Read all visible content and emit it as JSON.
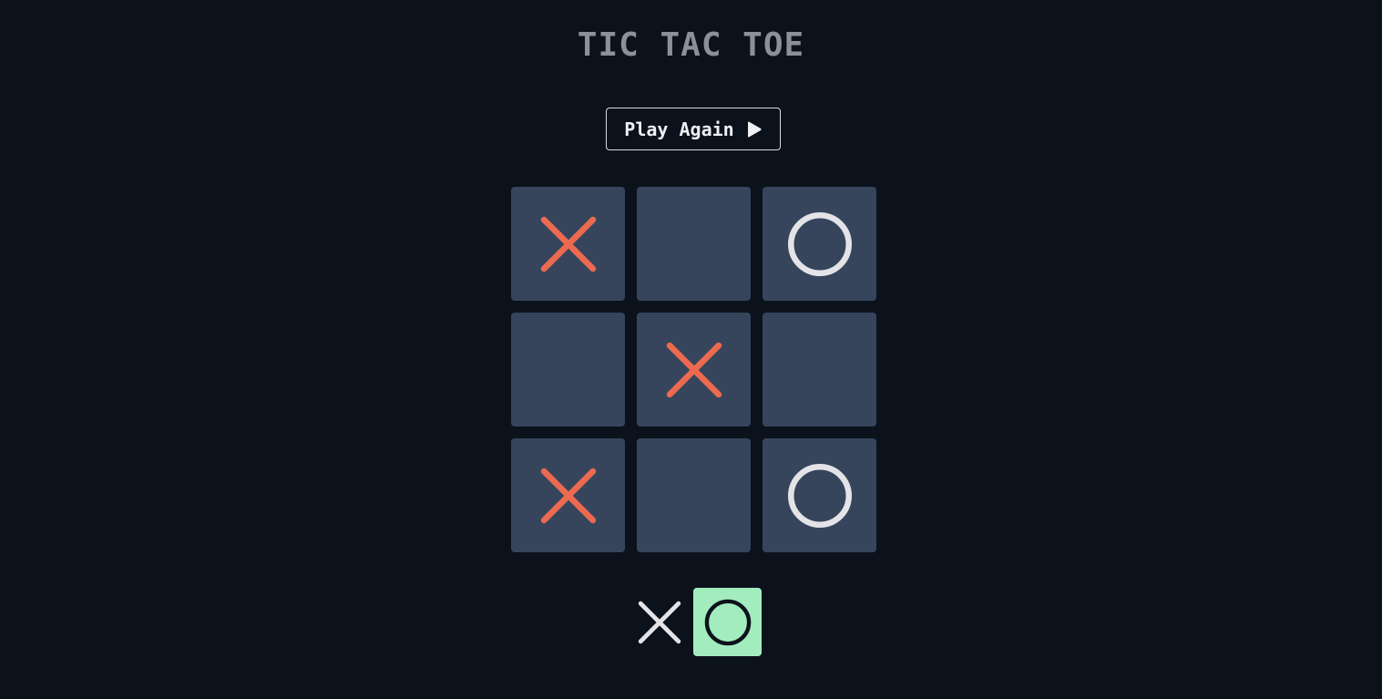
{
  "title": "TIC TAC TOE",
  "play_again": {
    "label": "Play Again",
    "icon": "play-icon"
  },
  "board": {
    "cells": [
      "X",
      "",
      "O",
      "",
      "X",
      "",
      "X",
      "",
      "O"
    ]
  },
  "turn_indicator": {
    "players": [
      "X",
      "O"
    ],
    "current": "O"
  },
  "colors": {
    "background": "#0c121c",
    "cell": "#36455c",
    "x_mark": "#ec6a4f",
    "o_mark": "#e4e4e8",
    "active_turn": "#a3ecbe",
    "title": "#8b919b"
  }
}
